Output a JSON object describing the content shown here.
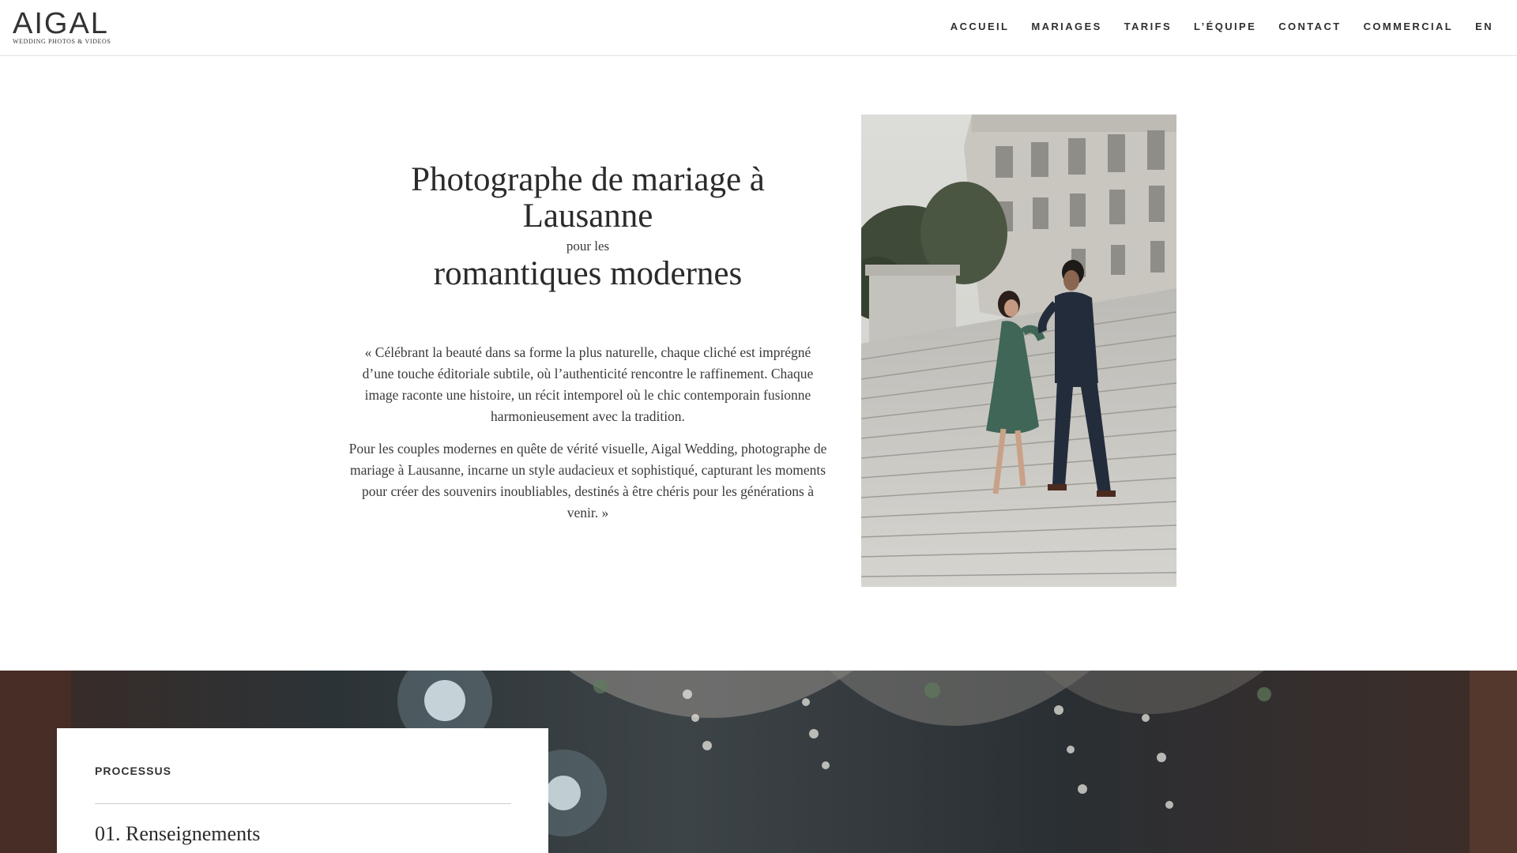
{
  "header": {
    "logo": {
      "main": "AIGAL",
      "sub": "WEDDING PHOTOS & VIDEOS"
    },
    "nav": [
      {
        "label": "ACCUEIL"
      },
      {
        "label": "MARIAGES"
      },
      {
        "label": "TARIFS"
      },
      {
        "label": "L’ÉQUIPE"
      },
      {
        "label": "CONTACT"
      },
      {
        "label": "COMMERCIAL"
      },
      {
        "label": "EN"
      }
    ]
  },
  "intro": {
    "title_line1": "Photographe de mariage à",
    "title_line2": "Lausanne",
    "title_small": "pour les",
    "title_sub": "romantiques modernes",
    "quote_p1": "« Célébrant la beauté dans sa forme la plus naturelle, chaque cliché est imprégné d’une touche éditoriale subtile, où l’authenticité rencontre le raffinement. Chaque image raconte une histoire, un récit intemporel où le chic contemporain fusionne harmonieusement avec la tradition.",
    "quote_p2": "Pour les couples modernes en quête de vérité visuelle, Aigal Wedding, photographe de mariage à Lausanne, incarne un style audacieux et sophistiqué, capturant les moments pour créer des souvenirs inoubliables, destinés à être chéris pour les générations à venir. »"
  },
  "process": {
    "label": "PROCESSUS",
    "step": "01. Renseignements"
  }
}
